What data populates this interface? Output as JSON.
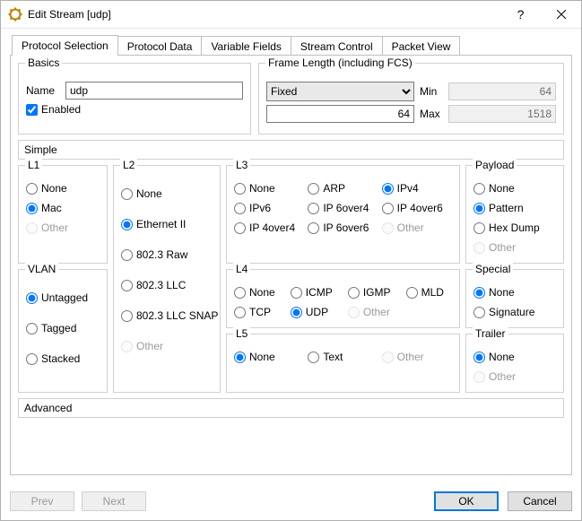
{
  "window": {
    "title": "Edit Stream [udp]"
  },
  "tabs": {
    "protocol_selection": "Protocol Selection",
    "protocol_data": "Protocol Data",
    "variable_fields": "Variable Fields",
    "stream_control": "Stream Control",
    "packet_view": "Packet View"
  },
  "basics": {
    "legend": "Basics",
    "name_label": "Name",
    "name_value": "udp",
    "enabled_label": "Enabled",
    "enabled_checked": true
  },
  "frame_length": {
    "legend": "Frame Length (including FCS)",
    "mode_selected": "Fixed",
    "value": "64",
    "min_label": "Min",
    "min_value": "64",
    "max_label": "Max",
    "max_value": "1518"
  },
  "sections": {
    "simple": "Simple",
    "advanced": "Advanced"
  },
  "l1": {
    "legend": "L1",
    "none": "None",
    "mac": "Mac",
    "other": "Other",
    "selected": "mac"
  },
  "vlan": {
    "legend": "VLAN",
    "untagged": "Untagged",
    "tagged": "Tagged",
    "stacked": "Stacked",
    "selected": "untagged"
  },
  "l2": {
    "legend": "L2",
    "none": "None",
    "eth2": "Ethernet II",
    "raw": "802.3 Raw",
    "llc": "802.3 LLC",
    "snap": "802.3 LLC SNAP",
    "other": "Other",
    "selected": "eth2"
  },
  "l3": {
    "legend": "L3",
    "none": "None",
    "arp": "ARP",
    "ipv4": "IPv4",
    "ipv6": "IPv6",
    "ip6o4": "IP 6over4",
    "ip4o6": "IP 4over6",
    "ip4o4": "IP 4over4",
    "ip6o6": "IP 6over6",
    "other": "Other",
    "selected": "ipv4"
  },
  "l4": {
    "legend": "L4",
    "none": "None",
    "icmp": "ICMP",
    "igmp": "IGMP",
    "mld": "MLD",
    "tcp": "TCP",
    "udp": "UDP",
    "other": "Other",
    "selected": "udp"
  },
  "l5": {
    "legend": "L5",
    "none": "None",
    "text": "Text",
    "other": "Other",
    "selected": "none"
  },
  "payload": {
    "legend": "Payload",
    "none": "None",
    "pattern": "Pattern",
    "hexdump": "Hex Dump",
    "other": "Other",
    "selected": "pattern"
  },
  "special": {
    "legend": "Special",
    "none": "None",
    "signature": "Signature",
    "selected": "none"
  },
  "trailer": {
    "legend": "Trailer",
    "none": "None",
    "other": "Other",
    "selected": "none"
  },
  "footer": {
    "prev": "Prev",
    "next": "Next",
    "ok": "OK",
    "cancel": "Cancel"
  }
}
